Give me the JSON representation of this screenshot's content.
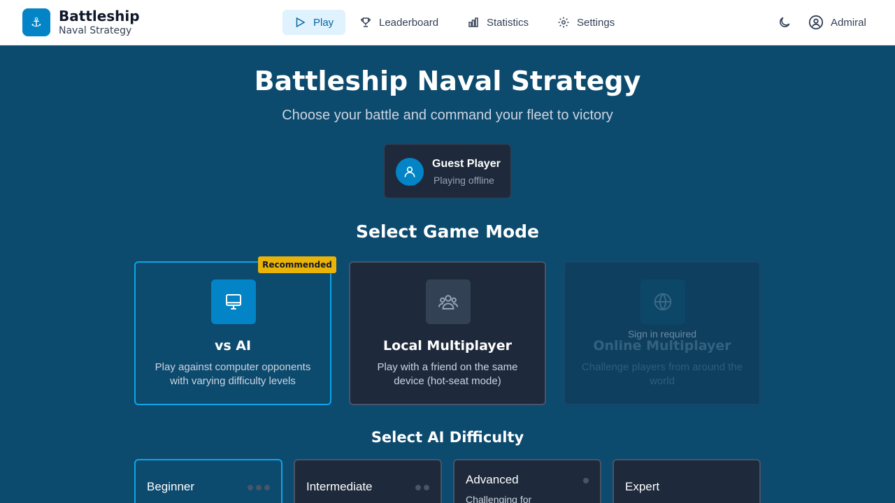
{
  "brand": {
    "title": "Battleship",
    "subtitle": "Naval Strategy",
    "logo_icon": "anchor-icon"
  },
  "nav": [
    {
      "label": "Play",
      "icon": "play-icon",
      "active": true
    },
    {
      "label": "Leaderboard",
      "icon": "trophy-icon",
      "active": false
    },
    {
      "label": "Statistics",
      "icon": "bar-chart-icon",
      "active": false
    },
    {
      "label": "Settings",
      "icon": "gear-icon",
      "active": false
    }
  ],
  "header": {
    "theme_icon": "moon-icon",
    "user_label": "Admiral",
    "user_icon": "user-circle-icon"
  },
  "hero": {
    "title": "Battleship Naval Strategy",
    "subtitle": "Choose your battle and command your fleet to victory"
  },
  "player": {
    "name": "Guest Player",
    "status": "Playing offline",
    "icon": "user-icon"
  },
  "mode_section": {
    "title": "Select Game Mode"
  },
  "modes": [
    {
      "name": "vs AI",
      "desc": "Play against computer opponents with varying difficulty levels",
      "icon": "monitor-icon",
      "badge": "Recommended"
    },
    {
      "name": "Local Multiplayer",
      "desc": "Play with a friend on the same device (hot-seat mode)",
      "icon": "users-icon"
    },
    {
      "name": "Online Multiplayer",
      "desc": "Challenge players from around the world",
      "icon": "globe-icon",
      "note": "Sign in required"
    }
  ],
  "difficulty_section": {
    "title": "Select AI Difficulty"
  },
  "difficulties": [
    {
      "name": "Beginner",
      "dots": 3
    },
    {
      "name": "Intermediate",
      "dots": 2
    },
    {
      "name": "Advanced",
      "desc": "Challenging for",
      "dots": 1
    },
    {
      "name": "Expert",
      "dots": 0
    }
  ],
  "colors": {
    "background": "#0c4a6e",
    "accent": "#0284c7",
    "badge": "#eab308",
    "card": "#1e293b"
  }
}
